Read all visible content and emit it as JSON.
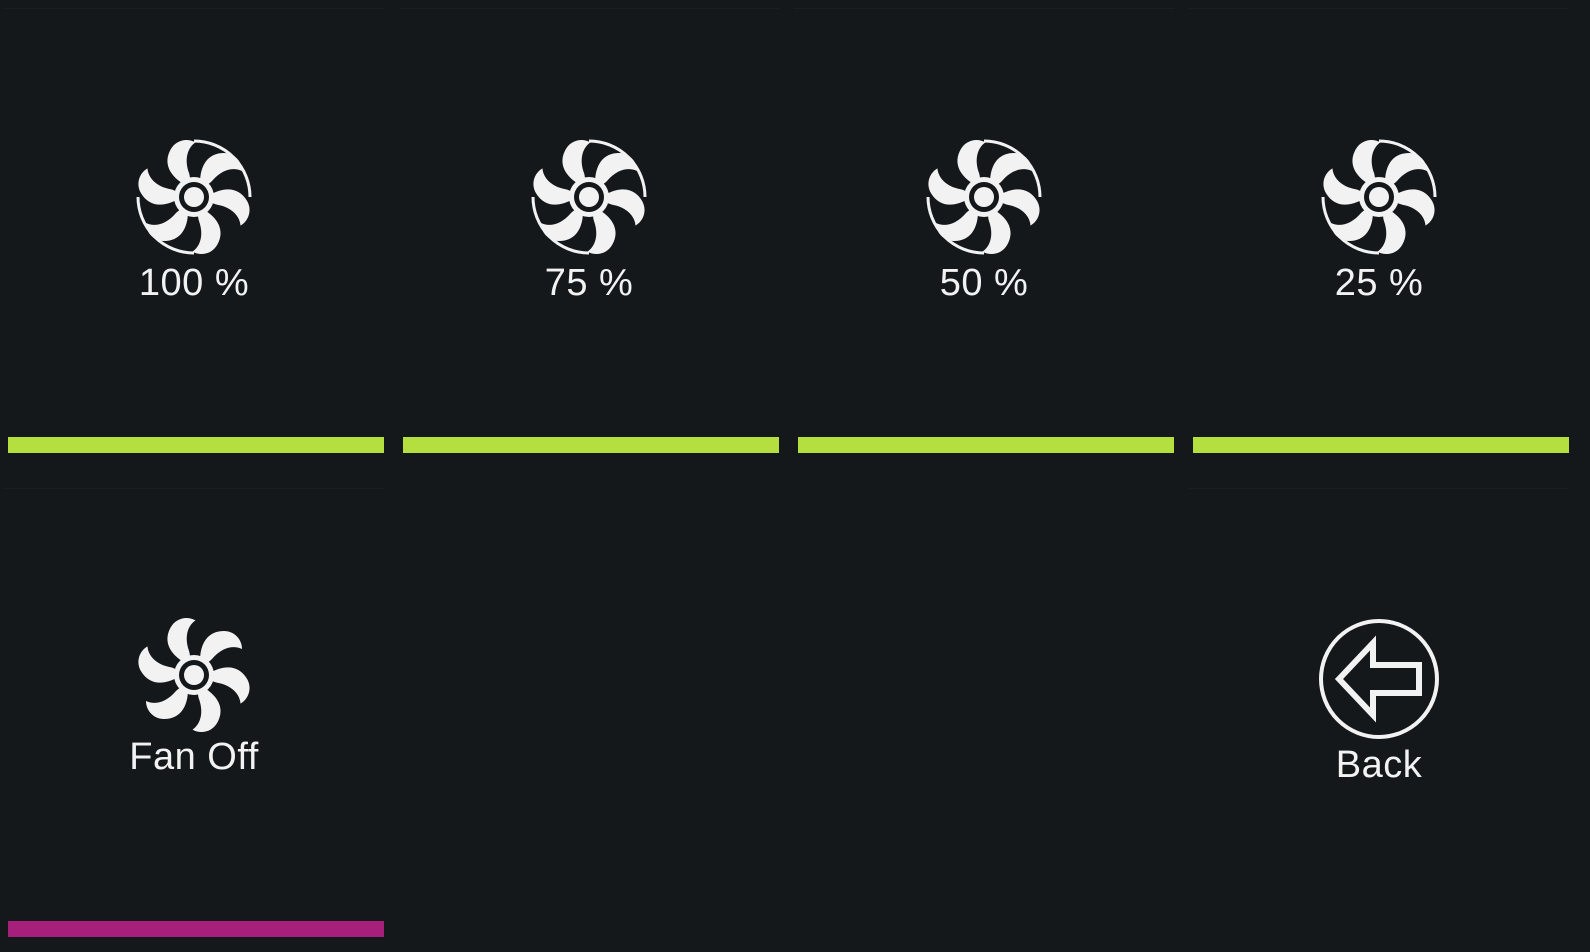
{
  "colors": {
    "background": "#15181b",
    "active_bar": "#b5de3f",
    "off_bar": "#a61f7b",
    "text": "#f2f2f2"
  },
  "tiles": [
    {
      "label": "100 %",
      "icon": "fan-speed-icon",
      "bar_color": "active"
    },
    {
      "label": "75 %",
      "icon": "fan-speed-icon",
      "bar_color": "active"
    },
    {
      "label": "50 %",
      "icon": "fan-speed-icon",
      "bar_color": "active"
    },
    {
      "label": "25 %",
      "icon": "fan-speed-icon",
      "bar_color": "active"
    },
    {
      "label": "Fan Off",
      "icon": "fan-icon",
      "bar_color": "off"
    },
    {
      "label": "Back",
      "icon": "back-arrow-icon"
    }
  ]
}
